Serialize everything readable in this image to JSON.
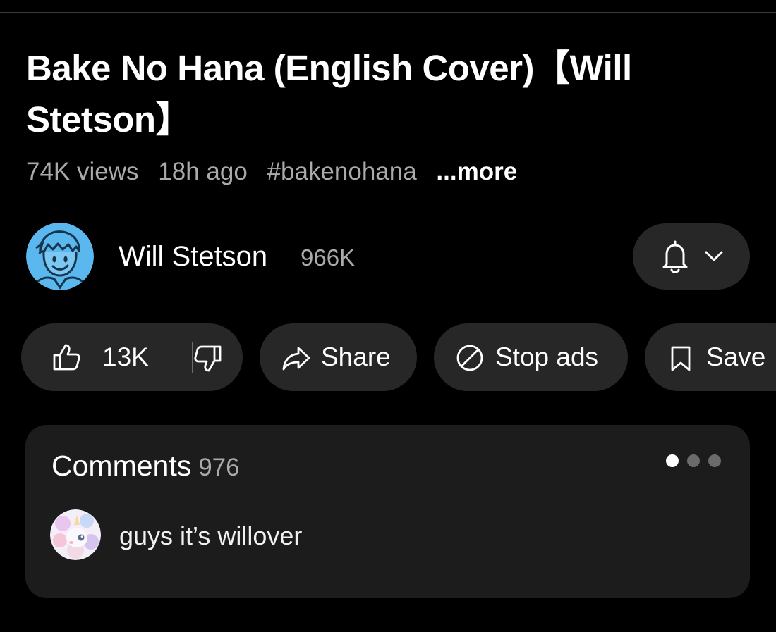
{
  "video": {
    "title": "Bake No Hana (English Cover)【Will Stetson】",
    "views": "74K views",
    "age": "18h ago",
    "hashtag": "#bakenohana",
    "more_label": "...more"
  },
  "channel": {
    "name": "Will Stetson",
    "subscribers": "966K",
    "avatar_icon": "cartoon-face-avatar-icon",
    "subscribe_icon": "bell-icon",
    "dropdown_icon": "chevron-down-icon"
  },
  "actions": {
    "like_count": "13K",
    "like_icon": "thumbs-up-icon",
    "dislike_icon": "thumbs-down-icon",
    "share_label": "Share",
    "share_icon": "share-arrow-icon",
    "stop_ads_label": "Stop ads",
    "stop_ads_icon": "block-icon",
    "save_label": "Save",
    "save_icon": "bookmark-icon"
  },
  "comments": {
    "title": "Comments",
    "count": "976",
    "pager_dots": 3,
    "pager_active": 1,
    "top_comment": {
      "text": "guys it’s willover",
      "avatar_icon": "unicorn-avatar-icon"
    }
  },
  "colors": {
    "background": "#000000",
    "pill": "#272727",
    "card": "#1c1c1c",
    "secondary_text": "#aaaaaa",
    "avatar_blue": "#5bb8ee"
  }
}
